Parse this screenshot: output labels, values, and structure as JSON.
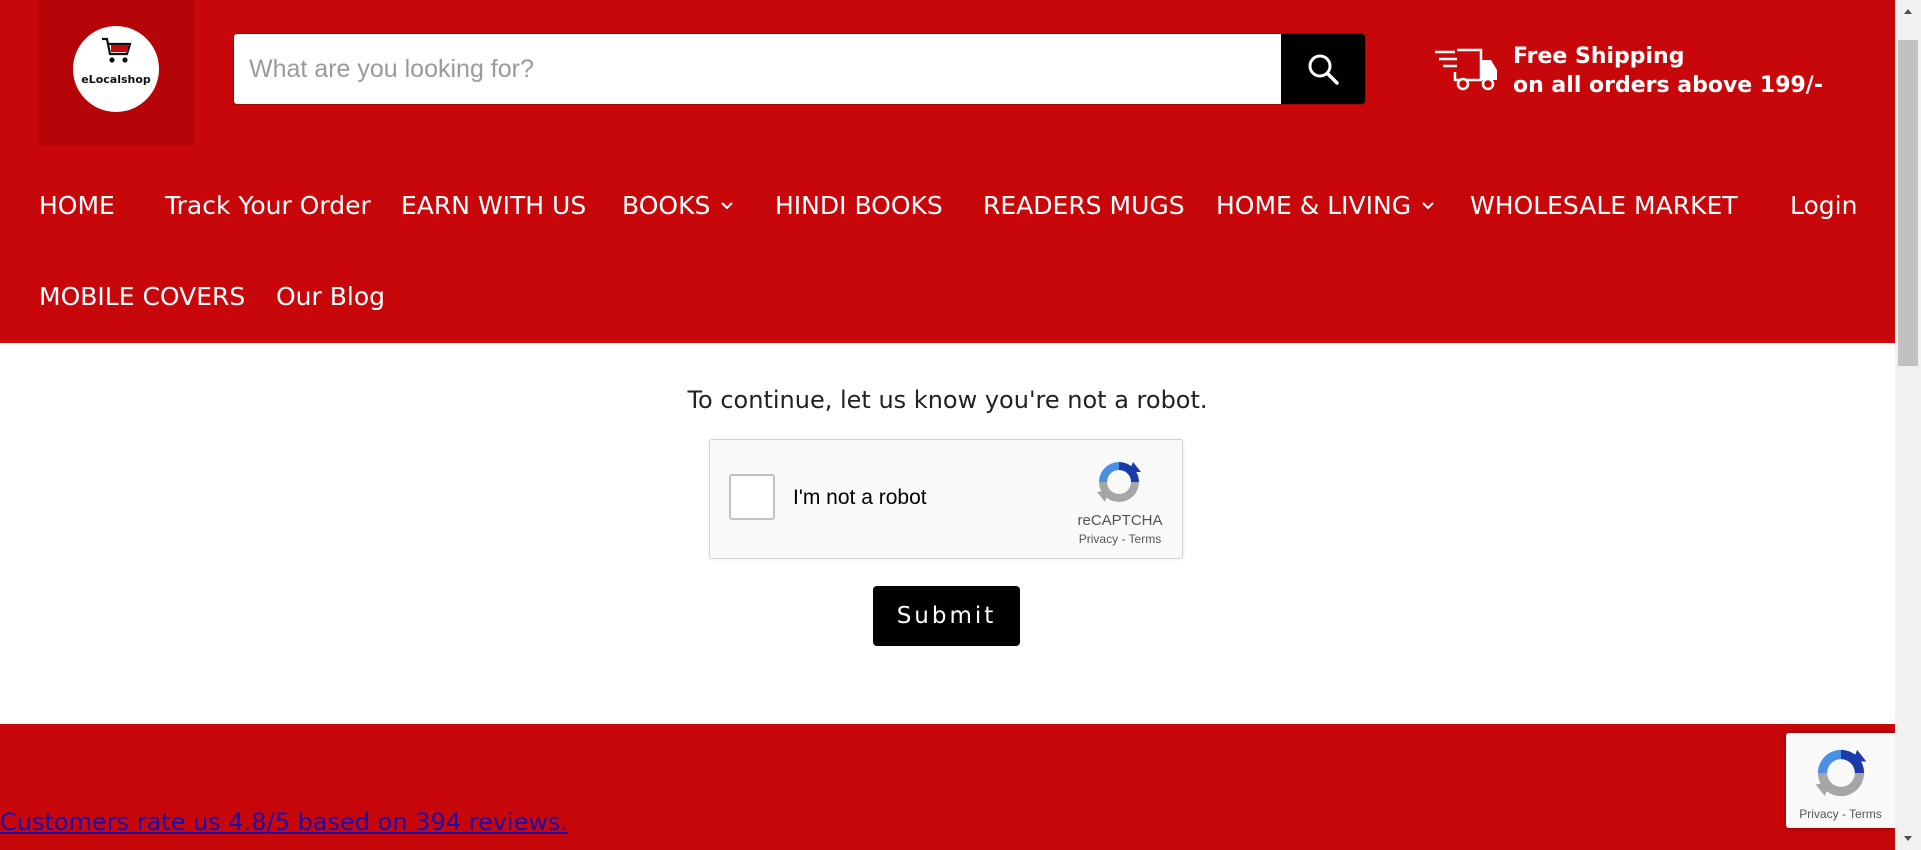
{
  "brand": {
    "logo_text": "eLocalshop"
  },
  "search": {
    "placeholder": "What are you looking for?"
  },
  "shipping": {
    "line1": "Free Shipping",
    "line2": "on all orders above 199/-"
  },
  "nav": {
    "home": "HOME",
    "track_order": "Track Your Order",
    "earn": "EARN WITH US",
    "books": "BOOKS",
    "hindi_books": "HINDI BOOKS",
    "readers_mugs": "READERS MUGS",
    "home_living": "HOME & LIVING",
    "wholesale": "WHOLESALE MARKET",
    "login": "Login",
    "mobile_covers": "MOBILE COVERS",
    "blog": "Our Blog"
  },
  "main": {
    "prompt": "To continue, let us know you're not a robot.",
    "captcha_label": "I'm not a robot",
    "captcha_brand": "reCAPTCHA",
    "captcha_links": "Privacy - Terms",
    "submit_label": "Submit"
  },
  "footer": {
    "reviews_text": "Customers rate us 4.8/5 based on 394 reviews.",
    "badge_links": "Privacy - Terms"
  },
  "colors": {
    "brand_red": "#c8070b",
    "dark_red": "#b50508",
    "black": "#000000",
    "link_blue": "#1a0dab"
  },
  "icons": [
    "cart-icon",
    "search-icon",
    "truck-icon",
    "chevron-down-icon",
    "recaptcha-icon"
  ]
}
